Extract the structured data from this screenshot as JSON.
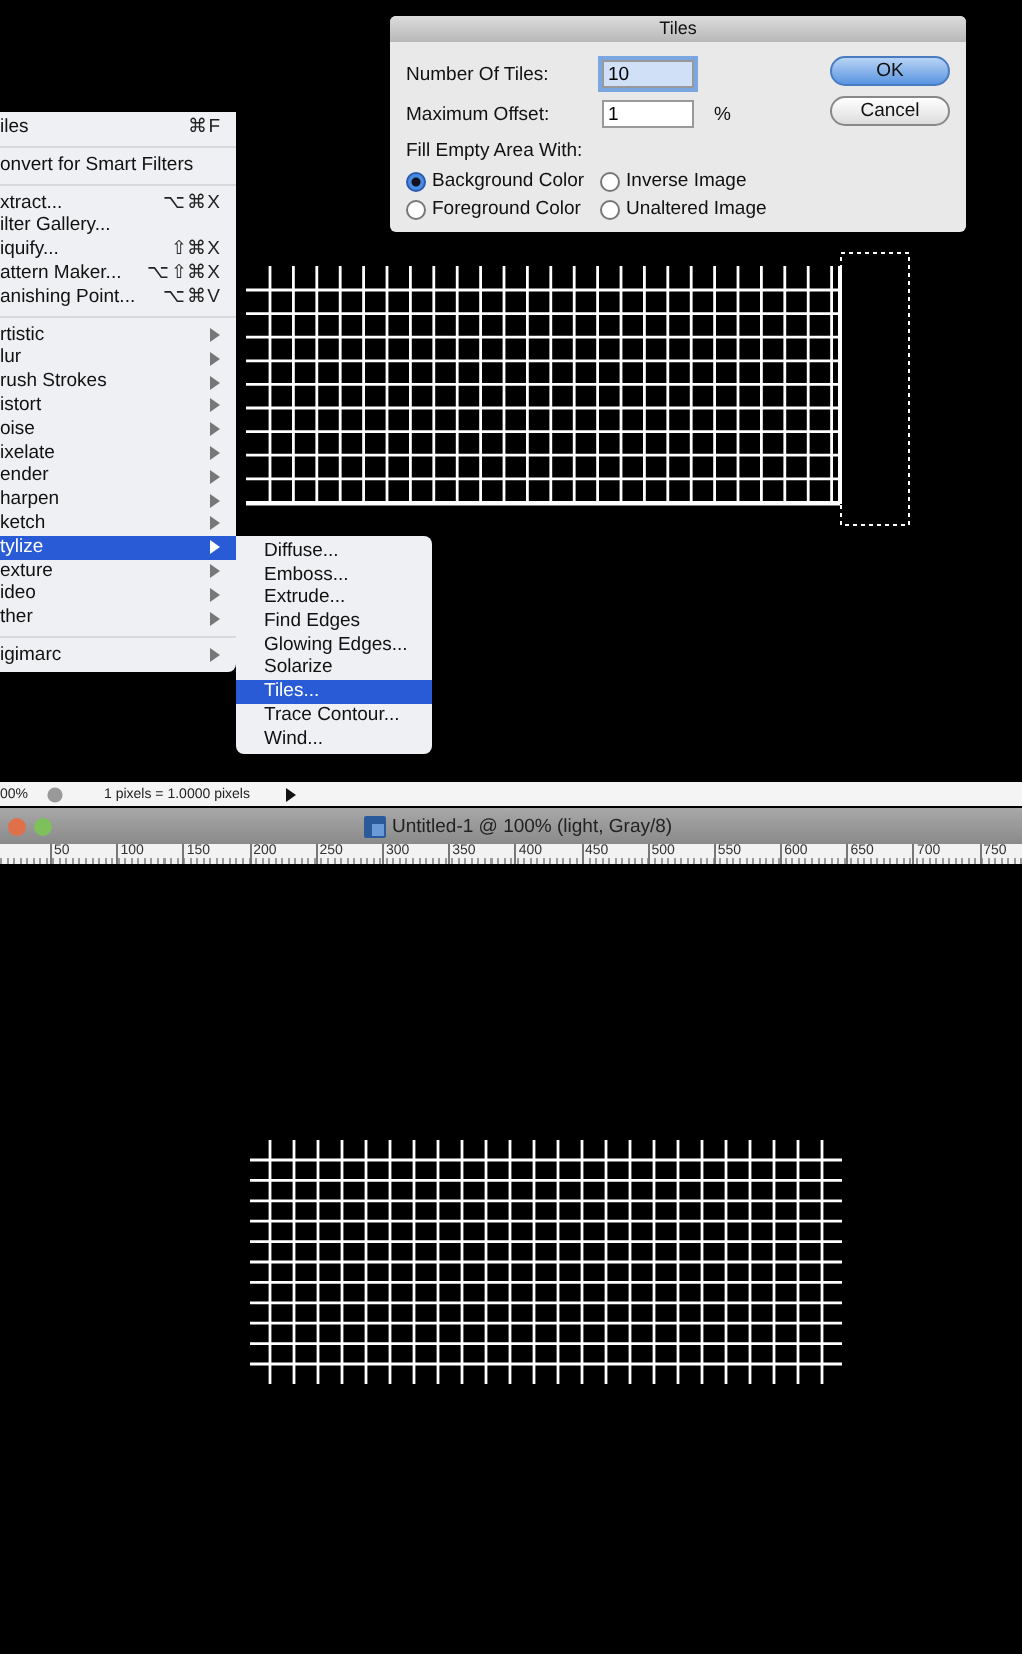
{
  "filter_menu": {
    "items": [
      {
        "kind": "command",
        "label": "iles",
        "shortcut": "⌘F"
      },
      {
        "kind": "separator"
      },
      {
        "kind": "command",
        "label": "onvert for Smart Filters"
      },
      {
        "kind": "separator"
      },
      {
        "kind": "command",
        "label": "xtract...",
        "shortcut": "⌥⌘X"
      },
      {
        "kind": "command",
        "label": "ilter Gallery..."
      },
      {
        "kind": "command",
        "label": "iquify...",
        "shortcut": "⇧⌘X"
      },
      {
        "kind": "command",
        "label": "attern Maker...",
        "shortcut": "⌥⇧⌘X"
      },
      {
        "kind": "command",
        "label": "anishing Point...",
        "shortcut": "⌥⌘V"
      },
      {
        "kind": "separator"
      },
      {
        "kind": "submenu",
        "label": "rtistic",
        "selected": false
      },
      {
        "kind": "submenu",
        "label": "lur",
        "selected": false
      },
      {
        "kind": "submenu",
        "label": "rush Strokes",
        "selected": false
      },
      {
        "kind": "submenu",
        "label": "istort",
        "selected": false
      },
      {
        "kind": "submenu",
        "label": "oise",
        "selected": false
      },
      {
        "kind": "submenu",
        "label": "ixelate",
        "selected": false
      },
      {
        "kind": "submenu",
        "label": "ender",
        "selected": false
      },
      {
        "kind": "submenu",
        "label": "harpen",
        "selected": false
      },
      {
        "kind": "submenu",
        "label": "ketch",
        "selected": false
      },
      {
        "kind": "submenu",
        "label": "tylize",
        "selected": true
      },
      {
        "kind": "submenu",
        "label": "exture",
        "selected": false
      },
      {
        "kind": "submenu",
        "label": "ideo",
        "selected": false
      },
      {
        "kind": "submenu",
        "label": "ther",
        "selected": false
      },
      {
        "kind": "separator"
      },
      {
        "kind": "submenu",
        "label": "igimarc",
        "selected": false
      }
    ]
  },
  "stylize_submenu": {
    "items": [
      {
        "label": "Diffuse...",
        "selected": false
      },
      {
        "label": "Emboss...",
        "selected": false
      },
      {
        "label": "Extrude...",
        "selected": false
      },
      {
        "label": "Find Edges",
        "selected": false
      },
      {
        "label": "Glowing Edges...",
        "selected": false
      },
      {
        "label": "Solarize",
        "selected": false
      },
      {
        "label": "Tiles...",
        "selected": true
      },
      {
        "label": "Trace Contour...",
        "selected": false
      },
      {
        "label": "Wind...",
        "selected": false
      }
    ]
  },
  "tiles_dialog": {
    "title": "Tiles",
    "fields": [
      {
        "label": "Number Of Tiles:",
        "value": "10",
        "focused": true
      },
      {
        "label": "Maximum Offset:",
        "value": "1",
        "unit": "%",
        "focused": false
      }
    ],
    "fill_label": "Fill Empty Area With:",
    "options": [
      {
        "label": "Background Color",
        "selected": true
      },
      {
        "label": "Inverse Image",
        "selected": false
      },
      {
        "label": "Foreground Color",
        "selected": false
      },
      {
        "label": "Unaltered Image",
        "selected": false
      }
    ],
    "buttons": [
      {
        "label": "OK",
        "default": true
      },
      {
        "label": "Cancel",
        "default": false
      }
    ]
  },
  "status_bar": {
    "zoom": "00%",
    "scale": "1 pixels = 1.0000 pixels"
  },
  "document_window": {
    "title": "Untitled-1 @ 100% (light, Gray/8)",
    "ruler": [
      "50",
      "100",
      "150",
      "200",
      "250",
      "300",
      "350",
      "400",
      "450",
      "500",
      "550",
      "600",
      "650",
      "700",
      "750"
    ]
  }
}
